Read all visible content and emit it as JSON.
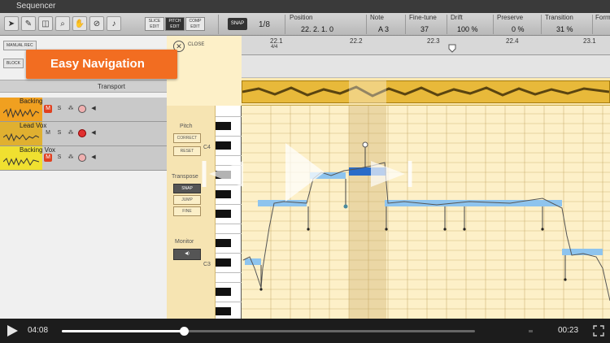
{
  "app": {
    "title": "Sequencer"
  },
  "toolbar": {
    "modes": [
      {
        "label": "SLICE EDIT",
        "active": false
      },
      {
        "label": "PITCH EDIT",
        "active": true
      },
      {
        "label": "COMP EDIT",
        "active": false
      }
    ],
    "snap_label": "SNAP",
    "snap_value": "1/8",
    "fields": [
      {
        "label": "Position",
        "value": "22. 2. 1.   0"
      },
      {
        "label": "Note",
        "value": "A 3"
      },
      {
        "label": "Fine-tune",
        "value": "37"
      },
      {
        "label": "Drift",
        "value": "100 %"
      },
      {
        "label": "Preserve",
        "value": "0 %"
      },
      {
        "label": "Transition",
        "value": "31 %"
      },
      {
        "label": "Form",
        "value": ""
      }
    ]
  },
  "left_panel": {
    "manual_rec_label": "MANUAL REC",
    "block_label": "BLOCK",
    "transport_label": "Transport",
    "tracks": [
      {
        "name": "Backing",
        "color": "#f0a020",
        "mute": "M",
        "solo": "S",
        "armed": false
      },
      {
        "name": "Lead Vox",
        "color": "#e0b030",
        "mute": "M",
        "solo": "S",
        "armed": true
      },
      {
        "name": "Backing Vox",
        "color": "#f0e030",
        "mute": "M",
        "solo": "S",
        "armed": false
      }
    ]
  },
  "banner": {
    "text": "Easy Navigation"
  },
  "editor": {
    "close_label": "CLOSE",
    "ruler": [
      {
        "label": "22.1",
        "sub": "4/4"
      },
      {
        "label": "22.2",
        "sub": ""
      },
      {
        "label": "22.3",
        "sub": ""
      },
      {
        "label": "22.4",
        "sub": ""
      },
      {
        "label": "23.1",
        "sub": ""
      }
    ],
    "pitch_title": "Pitch",
    "correct_label": "CORRECT",
    "reset_label": "RESET",
    "transpose_title": "Transpose",
    "snap_label": "SNAP",
    "jump_label": "JUMP",
    "fine_label": "FINE",
    "monitor_title": "Monitor",
    "octave_labels": [
      "C4",
      "C3"
    ]
  },
  "player": {
    "elapsed": "04:08",
    "remaining": "00:23",
    "progress": 0.295
  },
  "colors": {
    "accent": "#f26d21",
    "note_blue": "#8ec4ee",
    "note_selected": "#2a6cc8",
    "mute_red": "#e04020"
  }
}
